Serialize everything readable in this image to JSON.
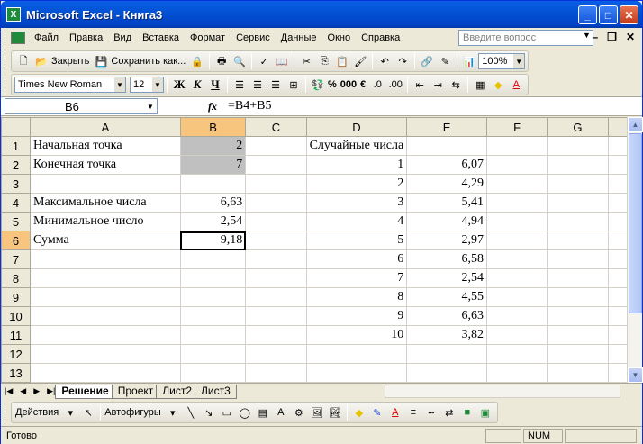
{
  "window": {
    "title": "Microsoft Excel - Книга3",
    "app_icon": "X"
  },
  "menubar": {
    "items": [
      "Файл",
      "Правка",
      "Вид",
      "Вставка",
      "Формат",
      "Сервис",
      "Данные",
      "Окно",
      "Справка"
    ],
    "ask_placeholder": "Введите вопрос"
  },
  "toolbar1": {
    "close_label": "Закрыть",
    "save_as_label": "Сохранить как...",
    "zoom": "100%"
  },
  "toolbar2": {
    "font": "Times New Roman",
    "size": "12",
    "bold": "Ж",
    "italic": "К",
    "underline": "Ч",
    "percent": "%",
    "thousands": "000",
    "euro": "€"
  },
  "formula_bar": {
    "cell": "B6",
    "fx": "fx",
    "formula": "=B4+B5"
  },
  "columns": [
    "A",
    "B",
    "C",
    "D",
    "E",
    "F",
    "G"
  ],
  "selected_column": "B",
  "selected_row": "6",
  "rows": [
    {
      "n": "1",
      "a": "Начальная точка",
      "b": "2",
      "c": "",
      "d": "Случайные числа",
      "e": "",
      "f": "",
      "g": ""
    },
    {
      "n": "2",
      "a": "Конечная точка",
      "b": "7",
      "c": "",
      "d": "1",
      "e": "6,07",
      "f": "",
      "g": ""
    },
    {
      "n": "3",
      "a": "",
      "b": "",
      "c": "",
      "d": "2",
      "e": "4,29",
      "f": "",
      "g": ""
    },
    {
      "n": "4",
      "a": "Максимальное числа",
      "b": "6,63",
      "c": "",
      "d": "3",
      "e": "5,41",
      "f": "",
      "g": ""
    },
    {
      "n": "5",
      "a": "Минимальное число",
      "b": "2,54",
      "c": "",
      "d": "4",
      "e": "4,94",
      "f": "",
      "g": ""
    },
    {
      "n": "6",
      "a": "Сумма",
      "b": "9,18",
      "c": "",
      "d": "5",
      "e": "2,97",
      "f": "",
      "g": ""
    },
    {
      "n": "7",
      "a": "",
      "b": "",
      "c": "",
      "d": "6",
      "e": "6,58",
      "f": "",
      "g": ""
    },
    {
      "n": "8",
      "a": "",
      "b": "",
      "c": "",
      "d": "7",
      "e": "2,54",
      "f": "",
      "g": ""
    },
    {
      "n": "9",
      "a": "",
      "b": "",
      "c": "",
      "d": "8",
      "e": "4,55",
      "f": "",
      "g": ""
    },
    {
      "n": "10",
      "a": "",
      "b": "",
      "c": "",
      "d": "9",
      "e": "6,63",
      "f": "",
      "g": ""
    },
    {
      "n": "11",
      "a": "",
      "b": "",
      "c": "",
      "d": "10",
      "e": "3,82",
      "f": "",
      "g": ""
    },
    {
      "n": "12",
      "a": "",
      "b": "",
      "c": "",
      "d": "",
      "e": "",
      "f": "",
      "g": ""
    },
    {
      "n": "13",
      "a": "",
      "b": "",
      "c": "",
      "d": "",
      "e": "",
      "f": "",
      "g": ""
    }
  ],
  "sheet_tabs": [
    "Решение",
    "Проект",
    "Лист2",
    "Лист3"
  ],
  "active_tab": "Решение",
  "drawing_toolbar": {
    "actions_label": "Действия",
    "autoshapes_label": "Автофигуры"
  },
  "status": {
    "ready": "Готово",
    "num": "NUM"
  },
  "colors": {
    "title_bar": "#0453D5",
    "selected_header": "#F8C57F",
    "gray_cells": "#C0C0C0"
  }
}
